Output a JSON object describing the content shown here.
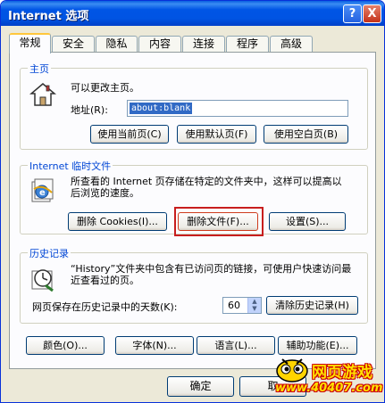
{
  "window": {
    "title": "Internet 选项",
    "help_glyph": "?",
    "close_glyph": "X"
  },
  "tabs": [
    {
      "label": "常规",
      "active": true
    },
    {
      "label": "安全"
    },
    {
      "label": "隐私"
    },
    {
      "label": "内容"
    },
    {
      "label": "连接"
    },
    {
      "label": "程序"
    },
    {
      "label": "高级"
    }
  ],
  "homepage": {
    "title": "主页",
    "description": "可以更改主页。",
    "address_label": "地址(R):",
    "address_value": "about:blank",
    "buttons": {
      "use_current": "使用当前页(C)",
      "use_default": "使用默认页(F)",
      "use_blank": "使用空白页(B)"
    }
  },
  "temp_files": {
    "title": "Internet 临时文件",
    "description": "所查看的 Internet 页存储在特定的文件夹中，这样可以提高以后浏览的速度。",
    "buttons": {
      "delete_cookies": "删除 Cookies(I)...",
      "delete_files": "删除文件(F)...",
      "settings": "设置(S)..."
    }
  },
  "history": {
    "title": "历史记录",
    "description": "“History”文件夹中包含有已访问页的链接，可使用户快速访问最近查看过的页。",
    "days_label": "网页保存在历史记录中的天数(K):",
    "days_value": "60",
    "clear_button": "清除历史记录(H)"
  },
  "bottom_row": {
    "colors": "颜色(O)...",
    "fonts": "字体(N)...",
    "languages": "语言(L)...",
    "accessibility": "辅助功能(E)..."
  },
  "dialog_buttons": {
    "ok": "确定",
    "cancel": "取"
  },
  "watermark": {
    "line1": "网页游戏",
    "line2": "www.40407.com"
  },
  "colors": {
    "titlebar": "#0054e3",
    "group_title": "#0046d5",
    "highlight_box": "#c81e1e",
    "selection": "#316ac5"
  }
}
